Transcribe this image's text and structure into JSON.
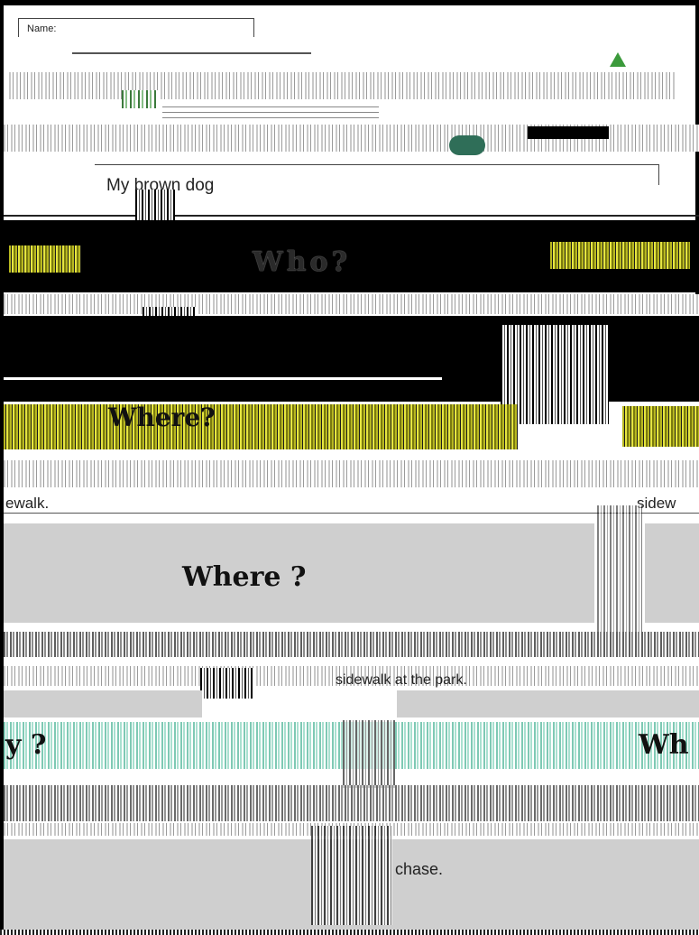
{
  "worksheet": {
    "name_label": "Name:",
    "dog_sentence": "My brown dog",
    "who_heading": "Who?",
    "where_heading_1": "Where?",
    "sidewalk_fragment_1": "ewalk.",
    "sidewalk_fragment_2": "sidew",
    "where_heading_2": "Where ?",
    "sidewalk_park": "sidewalk at the park.",
    "why_fragment": "y ?",
    "wh_fragment": "Wh",
    "chase_word": "chase."
  }
}
